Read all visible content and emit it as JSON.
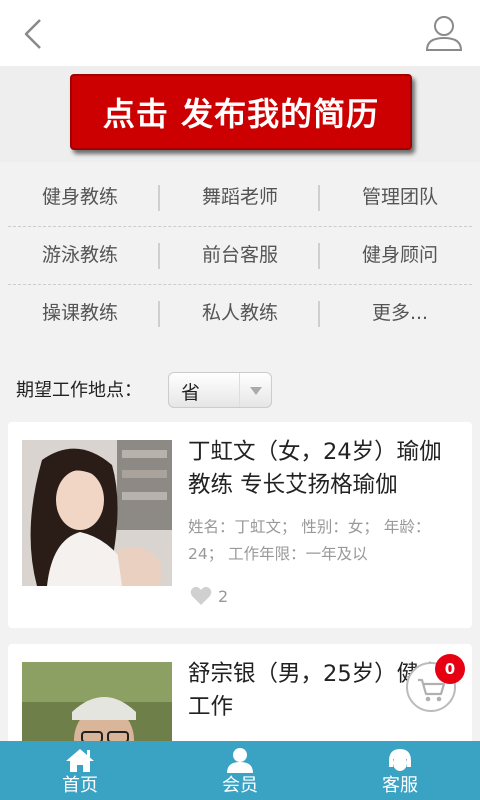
{
  "header": {
    "back_icon": "chevron-left-icon",
    "user_icon": "user-icon"
  },
  "banner": {
    "label": "点击 发布我的简历",
    "color": "#cc0000"
  },
  "categories": [
    [
      "健身教练",
      "舞蹈老师",
      "管理团队"
    ],
    [
      "游泳教练",
      "前台客服",
      "健身顾问"
    ],
    [
      "操课教练",
      "私人教练",
      "更多..."
    ]
  ],
  "location": {
    "label": "期望工作地点：",
    "select_value": "省"
  },
  "resumes": [
    {
      "title": "丁虹文（女，24岁）瑜伽教练 专长艾扬格瑜伽",
      "detail": "姓名：丁虹文；  性别：女；  年龄：24；  工作年限：一年及以",
      "likes": "2"
    },
    {
      "title": "舒宗银（男，25岁）健身工作",
      "detail": "",
      "likes": ""
    }
  ],
  "cart": {
    "badge": "0"
  },
  "bottom_nav": [
    {
      "label": "首页",
      "icon": "home-icon"
    },
    {
      "label": "会员",
      "icon": "member-icon"
    },
    {
      "label": "客服",
      "icon": "customer-service-icon"
    }
  ],
  "colors": {
    "accent": "#3aa3c4",
    "badge": "#e60012"
  }
}
